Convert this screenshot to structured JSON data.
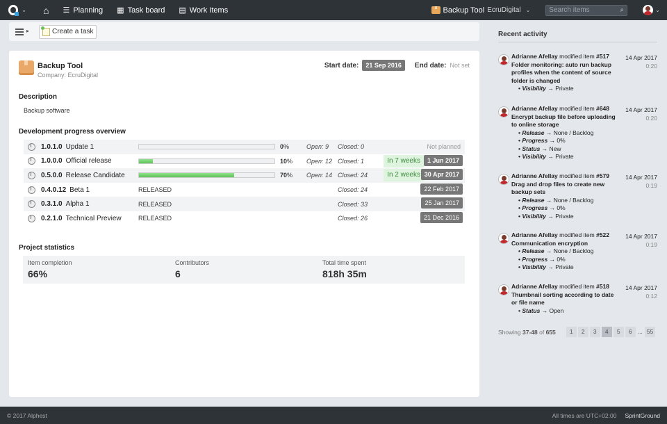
{
  "topbar": {
    "nav": [
      {
        "label": "Planning",
        "icon": "planning-icon"
      },
      {
        "label": "Task board",
        "icon": "taskboard-icon"
      },
      {
        "label": "Work Items",
        "icon": "workitems-icon"
      }
    ],
    "project": "Backup Tool",
    "company": "EcruDigital",
    "search_placeholder": "Search items"
  },
  "toolbar": {
    "create_label": "Create a task"
  },
  "project": {
    "name": "Backup Tool",
    "company_line": "Company: EcruDigital",
    "start_label": "Start date:",
    "start_date": "21 Sep 2016",
    "end_label": "End date:",
    "end_date": "Not set"
  },
  "description": {
    "title": "Description",
    "text": "Backup software"
  },
  "progress": {
    "title": "Development progress overview",
    "releases": [
      {
        "version": "1.0.1.0",
        "name": "Update 1",
        "pct": 0,
        "pct_text": "0",
        "open": "Open: 9",
        "closed": "Closed: 0",
        "eta": "",
        "date": "Not planned",
        "released": false
      },
      {
        "version": "1.0.0.0",
        "name": "Official release",
        "pct": 10,
        "pct_text": "10",
        "open": "Open: 12",
        "closed": "Closed: 1",
        "eta": "In 7 weeks",
        "date": "1 Jun 2017",
        "released": false
      },
      {
        "version": "0.5.0.0",
        "name": "Release Candidate",
        "pct": 70,
        "pct_text": "70",
        "open": "Open: 14",
        "closed": "Closed: 24",
        "eta": "In 2 weeks",
        "date": "30 Apr 2017",
        "released": false
      },
      {
        "version": "0.4.0.12",
        "name": "Beta 1",
        "status": "RELEASED",
        "closed": "Closed: 24",
        "date": "22 Feb 2017",
        "released": true
      },
      {
        "version": "0.3.1.0",
        "name": "Alpha 1",
        "status": "RELEASED",
        "closed": "Closed: 33",
        "date": "25 Jan 2017",
        "released": true
      },
      {
        "version": "0.2.1.0",
        "name": "Technical Preview",
        "status": "RELEASED",
        "closed": "Closed: 26",
        "date": "21 Dec 2016",
        "released": true
      }
    ]
  },
  "stats": {
    "title": "Project statistics",
    "items": [
      {
        "label": "Item completion",
        "value": "66%"
      },
      {
        "label": "Contributors",
        "value": "6"
      },
      {
        "label": "Total time spent",
        "value": "818h 35m"
      }
    ]
  },
  "activity": {
    "title": "Recent activity",
    "entries": [
      {
        "who": "Adrianne Afellay",
        "verb": "modified item",
        "item": "#517",
        "title": "Folder monitoring: auto run backup profiles when the content of source folder is changed",
        "changes": [
          [
            "Visibility",
            "Private"
          ]
        ],
        "date": "14 Apr 2017",
        "time": "0:20"
      },
      {
        "who": "Adrianne Afellay",
        "verb": "modified item",
        "item": "#648",
        "title": "Encrypt backup file before uploading to online storage",
        "changes": [
          [
            "Release",
            "None / Backlog"
          ],
          [
            "Progress",
            "0%"
          ],
          [
            "Status",
            "New"
          ],
          [
            "Visibility",
            "Private"
          ]
        ],
        "date": "14 Apr 2017",
        "time": "0:20"
      },
      {
        "who": "Adrianne Afellay",
        "verb": "modified item",
        "item": "#579",
        "title": "Drag and drop files to create new backup sets",
        "changes": [
          [
            "Release",
            "None / Backlog"
          ],
          [
            "Progress",
            "0%"
          ],
          [
            "Visibility",
            "Private"
          ]
        ],
        "date": "14 Apr 2017",
        "time": "0:19"
      },
      {
        "who": "Adrianne Afellay",
        "verb": "modified item",
        "item": "#522",
        "title": "Communication encryption",
        "changes": [
          [
            "Release",
            "None / Backlog"
          ],
          [
            "Progress",
            "0%"
          ],
          [
            "Visibility",
            "Private"
          ]
        ],
        "date": "14 Apr 2017",
        "time": "0:19"
      },
      {
        "who": "Adrianne Afellay",
        "verb": "modified item",
        "item": "#518",
        "title": "Thumbnail sorting according to date or file name",
        "changes": [
          [
            "Status",
            "Open"
          ]
        ],
        "date": "14 Apr 2017",
        "time": "0:12"
      }
    ],
    "arrow": "→",
    "pager": {
      "showing": "Showing",
      "range": "37-48",
      "of": "of",
      "total": "655",
      "pages": [
        "1",
        "2",
        "3",
        "4",
        "5",
        "6",
        "...",
        "55"
      ],
      "active": "4"
    }
  },
  "footer": {
    "copyright": "© 2017 Alphest",
    "timezone": "All times are UTC+02:00",
    "brand": "SprintGround"
  }
}
